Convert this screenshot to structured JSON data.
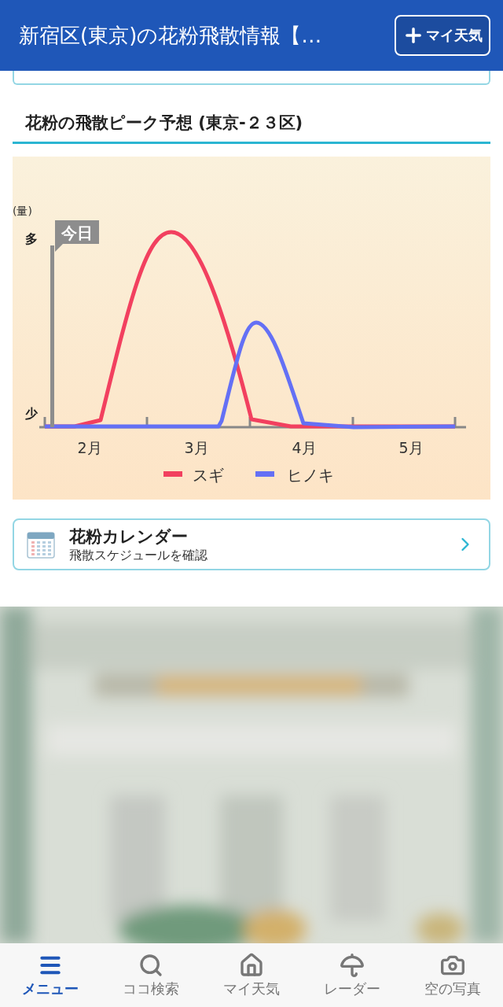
{
  "header": {
    "title": "新宿区(東京)の花粉飛散情報【…",
    "button": "マイ天気"
  },
  "section": {
    "title": "花粉の飛散ピーク予想 (東京-２３区)"
  },
  "chart": {
    "y_unit": "(量)",
    "y_high": "多",
    "y_low": "少",
    "today": "今日",
    "months": [
      "2月",
      "3月",
      "4月",
      "5月"
    ],
    "legend": [
      {
        "label": "スギ",
        "color": "#f2405f"
      },
      {
        "label": "ヒノキ",
        "color": "#6470f5"
      }
    ]
  },
  "calendar_link": {
    "title": "花粉カレンダー",
    "subtitle": "飛散スケジュールを確認"
  },
  "nav": [
    {
      "label": "メニュー",
      "selected": true
    },
    {
      "label": "ココ検索",
      "selected": false
    },
    {
      "label": "マイ天気",
      "selected": false
    },
    {
      "label": "レーダー",
      "selected": false
    },
    {
      "label": "空の写真",
      "selected": false
    }
  ]
}
